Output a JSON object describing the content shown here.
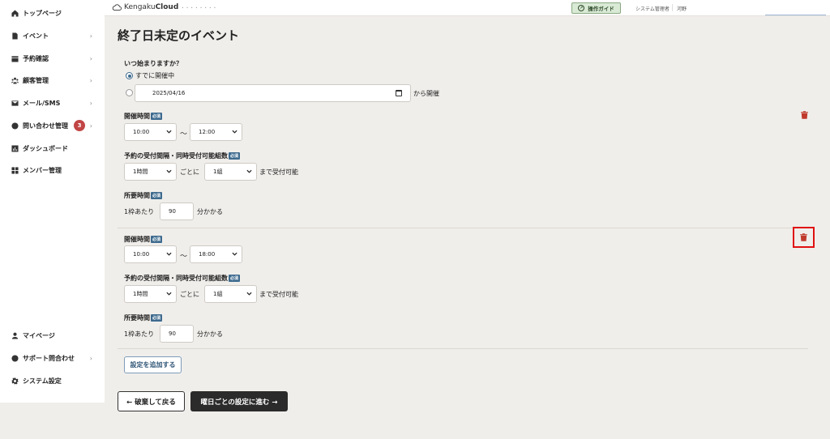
{
  "header": {
    "logo_prefix": "Kengaku",
    "logo_bold": "Cloud",
    "logo_sub": "• • • • • • • •",
    "guide_button": "操作ガイド",
    "user_role": "システム管理者",
    "user_name": "河野"
  },
  "sidebar": {
    "items": [
      {
        "label": "トップページ",
        "icon": "home-icon"
      },
      {
        "label": "イベント",
        "icon": "document-icon",
        "chevron": "›"
      },
      {
        "label": "予約確認",
        "icon": "calendar-icon",
        "chevron": "›"
      },
      {
        "label": "顧客管理",
        "icon": "users-icon",
        "chevron": "›"
      },
      {
        "label": "メール/SMS",
        "icon": "mail-icon",
        "chevron": "›"
      },
      {
        "label": "問い合わせ管理",
        "icon": "chat-icon",
        "badge": "3",
        "chevron": "›"
      },
      {
        "label": "ダッシュボード",
        "icon": "chart-icon"
      },
      {
        "label": "メンバー管理",
        "icon": "grid-icon"
      },
      {
        "label": "マイページ",
        "icon": "person-icon"
      },
      {
        "label": "サポート問合わせ",
        "icon": "help-icon",
        "chevron": "›"
      },
      {
        "label": "システム設定",
        "icon": "gear-icon"
      }
    ]
  },
  "main": {
    "title": "終了日未定のイベント",
    "start": {
      "question": "いつ始まりますか？",
      "option_now": "すでに開催中",
      "date_value": "2025/04/16",
      "date_suffix": "から開催"
    },
    "required_badge": "必須",
    "labels": {
      "hours": "開催時間",
      "interval": "予約の受付間隔・同時受付可能組数",
      "duration": "所要時間",
      "tilde": "〜",
      "per": "ごとに",
      "until": "まで受付可能",
      "per_slot": "1枠あたり",
      "takes": "分かかる"
    },
    "blocks": [
      {
        "start_time": "10:00",
        "end_time": "12:00",
        "interval": "1時間",
        "groups": "1組",
        "minutes": "90"
      },
      {
        "start_time": "10:00",
        "end_time": "18:00",
        "interval": "1時間",
        "groups": "1組",
        "minutes": "90"
      }
    ],
    "add_button": "設定を追加する",
    "back_button": "← 破棄して戻る",
    "next_button": "曜日ごとの設定に進む →"
  }
}
